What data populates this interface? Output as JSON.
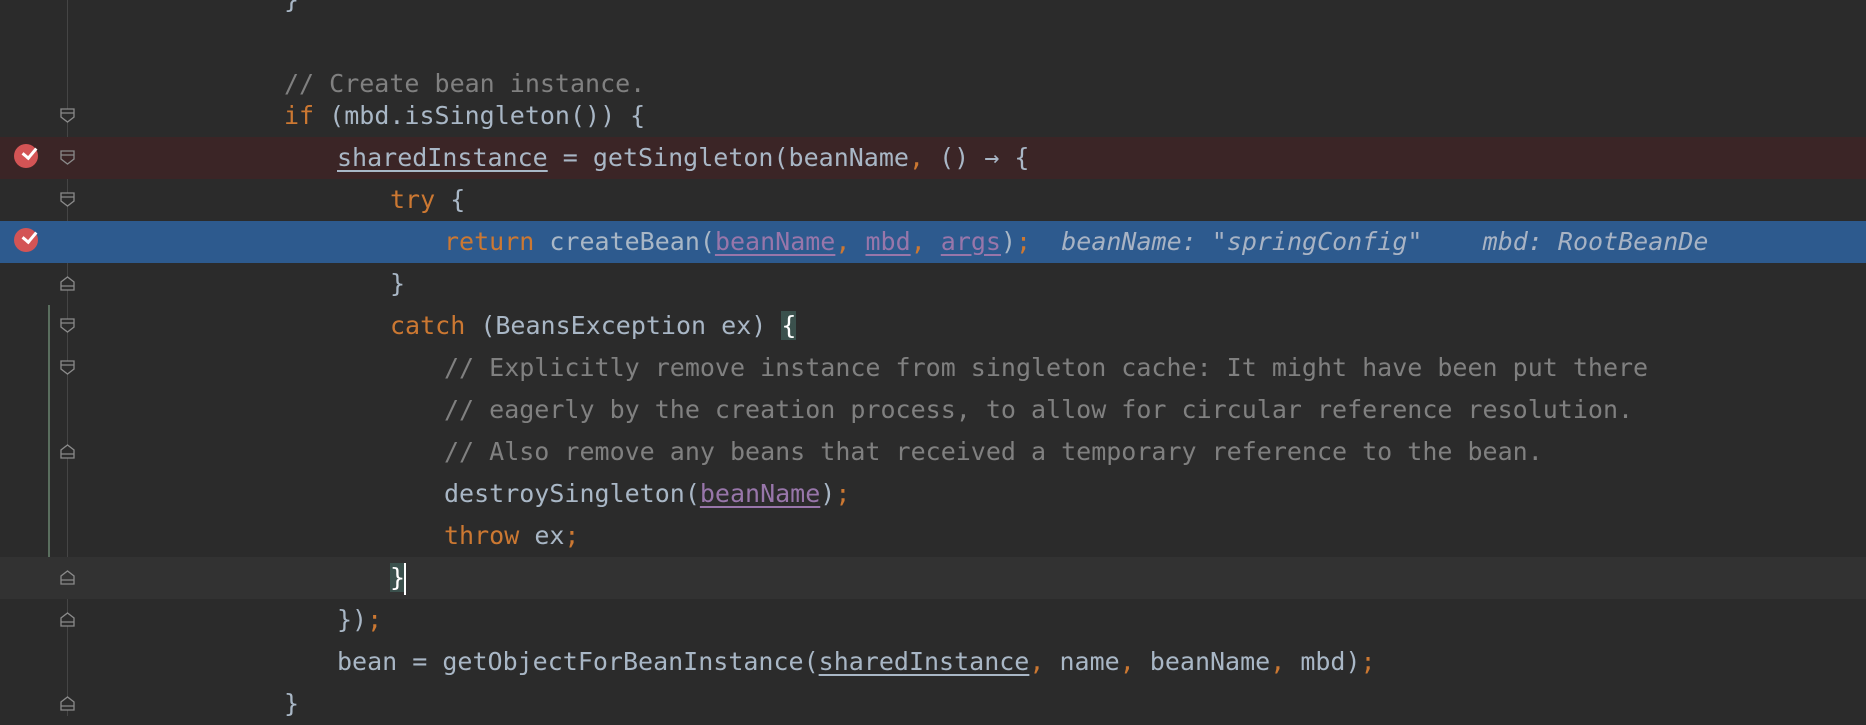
{
  "lines": [
    {
      "id": "l0",
      "tokens": [
        {
          "t": "}",
          "c": ""
        }
      ]
    },
    {
      "id": "l1",
      "tokens": []
    },
    {
      "id": "l2",
      "tokens": [
        {
          "t": "// Create bean instance.",
          "c": "cm"
        }
      ]
    },
    {
      "id": "l3",
      "tokens": [
        {
          "t": "if",
          "c": "kw"
        },
        {
          "t": " (mbd.isSingleton()) {",
          "c": ""
        }
      ]
    },
    {
      "id": "l4",
      "tokens": [
        {
          "t": "sharedInstance",
          "c": "uvar"
        },
        {
          "t": " = getSingleton(beanName",
          "c": ""
        },
        {
          "t": ",",
          "c": "punc"
        },
        {
          "t": " () → {",
          "c": ""
        }
      ]
    },
    {
      "id": "l5",
      "tokens": [
        {
          "t": "try",
          "c": "kw"
        },
        {
          "t": " {",
          "c": ""
        }
      ]
    },
    {
      "id": "l6",
      "tokens": [
        {
          "t": "return",
          "c": "kw"
        },
        {
          "t": " createBean(",
          "c": ""
        },
        {
          "t": "beanName",
          "c": "fld"
        },
        {
          "t": ",",
          "c": "punc"
        },
        {
          "t": " ",
          "c": ""
        },
        {
          "t": "mbd",
          "c": "fld"
        },
        {
          "t": ",",
          "c": "punc"
        },
        {
          "t": " ",
          "c": ""
        },
        {
          "t": "args",
          "c": "fld"
        },
        {
          "t": ")",
          "c": ""
        },
        {
          "t": ";",
          "c": "punc"
        },
        {
          "t": "  beanName: \"springConfig\"    mbd: RootBeanDe",
          "c": "inlay"
        }
      ]
    },
    {
      "id": "l7",
      "tokens": [
        {
          "t": "}",
          "c": ""
        }
      ]
    },
    {
      "id": "l8",
      "tokens": [
        {
          "t": "catch",
          "c": "kw"
        },
        {
          "t": " (BeansException ex) ",
          "c": ""
        },
        {
          "t": "{",
          "c": "brace-hl"
        }
      ]
    },
    {
      "id": "l9",
      "tokens": [
        {
          "t": "// Explicitly remove instance from singleton cache: It might have been put there",
          "c": "cm"
        }
      ]
    },
    {
      "id": "l10",
      "tokens": [
        {
          "t": "// eagerly by the creation process, to allow for circular reference resolution.",
          "c": "cm"
        }
      ]
    },
    {
      "id": "l11",
      "tokens": [
        {
          "t": "// Also remove any beans that received a temporary reference to the bean.",
          "c": "cm"
        }
      ]
    },
    {
      "id": "l12",
      "tokens": [
        {
          "t": "destroySingleton(",
          "c": ""
        },
        {
          "t": "beanName",
          "c": "fld"
        },
        {
          "t": ")",
          "c": ""
        },
        {
          "t": ";",
          "c": "punc"
        }
      ]
    },
    {
      "id": "l13",
      "tokens": [
        {
          "t": "throw",
          "c": "kw"
        },
        {
          "t": " ex",
          "c": ""
        },
        {
          "t": ";",
          "c": "punc"
        }
      ]
    },
    {
      "id": "l14",
      "tokens": [
        {
          "t": "}",
          "c": "brace-hl"
        }
      ]
    },
    {
      "id": "l15",
      "tokens": [
        {
          "t": "})",
          "c": ""
        },
        {
          "t": ";",
          "c": "punc"
        }
      ]
    },
    {
      "id": "l16",
      "tokens": [
        {
          "t": "bean = getObjectForBeanInstance(",
          "c": ""
        },
        {
          "t": "sharedInstance",
          "c": "uvar"
        },
        {
          "t": ",",
          "c": "punc"
        },
        {
          "t": " name",
          "c": ""
        },
        {
          "t": ",",
          "c": "punc"
        },
        {
          "t": " beanName",
          "c": ""
        },
        {
          "t": ",",
          "c": "punc"
        },
        {
          "t": " mbd)",
          "c": ""
        },
        {
          "t": ";",
          "c": "punc"
        }
      ]
    },
    {
      "id": "l17",
      "tokens": [
        {
          "t": "}",
          "c": ""
        }
      ]
    }
  ],
  "colors": {
    "background": "#2b2b2b",
    "keyword": "#cc7832",
    "comment": "#808080",
    "field": "#9876aa",
    "execution_line": "#2d5a8e",
    "breakpoint": "#d35455"
  },
  "icons": {
    "breakpoint": "breakpoint-verified-icon",
    "fold": "fold-marker-icon"
  }
}
